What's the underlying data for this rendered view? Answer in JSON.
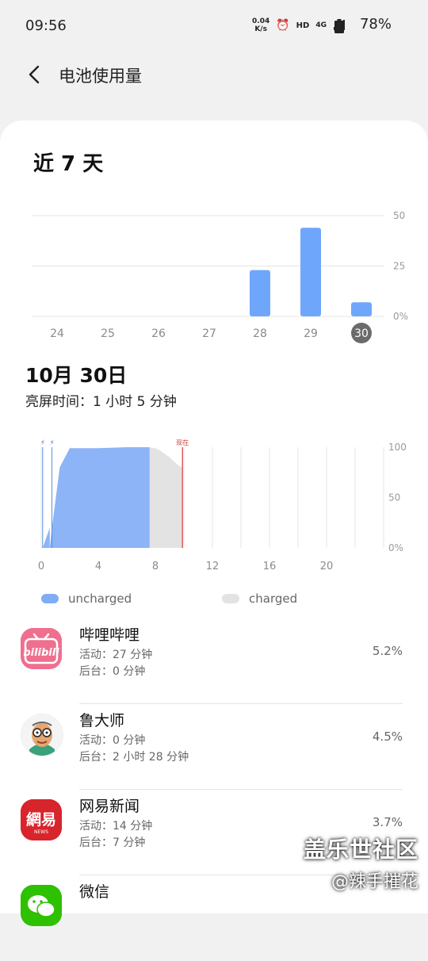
{
  "status_bar": {
    "time": "09:56",
    "net_speed_value": "0.04",
    "net_speed_unit": "K/s",
    "hd": "HD",
    "network": "4G",
    "battery": "78%"
  },
  "header": {
    "title": "电池使用量"
  },
  "period": "近 7 天",
  "weekly_chart": {
    "y_ticks": [
      "50",
      "25",
      "0%"
    ],
    "x_labels": [
      "24",
      "25",
      "26",
      "27",
      "28",
      "29",
      "30"
    ],
    "selected": "30"
  },
  "day": {
    "date": "10月 30日",
    "screen_time": "亮屏时间：1 小时 5 分钟",
    "now_label": "现在",
    "y_ticks": [
      "100",
      "50",
      "0%"
    ],
    "x_labels": [
      "0",
      "4",
      "8",
      "12",
      "16",
      "20"
    ]
  },
  "legend": [
    {
      "label": "uncharged",
      "color": "#7fadf5"
    },
    {
      "label": "charged",
      "color": "#e3e3e3"
    }
  ],
  "apps": [
    {
      "name": "哔哩哔哩",
      "active": "活动：27 分钟",
      "background": "后台：0 分钟",
      "percent": "5.2%",
      "icon": "bilibili-icon"
    },
    {
      "name": "鲁大师",
      "active": "活动：0 分钟",
      "background": "后台：2 小时 28 分钟",
      "percent": "4.5%",
      "icon": "ludashi-icon"
    },
    {
      "name": "网易新闻",
      "active": "活动：14 分钟",
      "background": "后台：7 分钟",
      "percent": "3.7%",
      "icon": "netease-news-icon"
    },
    {
      "name": "微信",
      "active": "",
      "background": "",
      "percent": "",
      "icon": "wechat-icon"
    }
  ],
  "watermark": {
    "line1": "盖乐世社区",
    "line2": "@辣手摧花"
  },
  "chart_data": [
    {
      "type": "bar",
      "title": "近 7 天",
      "categories": [
        "24",
        "25",
        "26",
        "27",
        "28",
        "29",
        "30"
      ],
      "values": [
        0,
        0,
        0,
        0,
        23,
        44,
        7
      ],
      "ylim": [
        0,
        50
      ],
      "yticks": [
        "0%",
        "25",
        "50"
      ],
      "grid": true,
      "color": "#6ea6fb"
    },
    {
      "type": "area",
      "title": "10月 30日",
      "xlim": [
        0,
        24
      ],
      "ylim": [
        0,
        100
      ],
      "xticks": [
        "0",
        "4",
        "8",
        "12",
        "16",
        "20"
      ],
      "yticks": [
        "0%",
        "50",
        "100"
      ],
      "series": [
        {
          "name": "uncharged",
          "x": [
            0.1,
            0.6,
            0.6,
            0.75,
            1.3,
            2.0,
            4.0,
            6.0,
            7.6,
            7.6
          ],
          "y": [
            0,
            20,
            0,
            20,
            80,
            99,
            99,
            100,
            100,
            0
          ]
        },
        {
          "name": "charged",
          "x": [
            7.6,
            7.6,
            8.2,
            9.0,
            9.6,
            9.9,
            9.9
          ],
          "y": [
            0,
            100,
            98,
            90,
            82,
            80,
            0
          ]
        }
      ],
      "now_x": 9.9
    }
  ]
}
